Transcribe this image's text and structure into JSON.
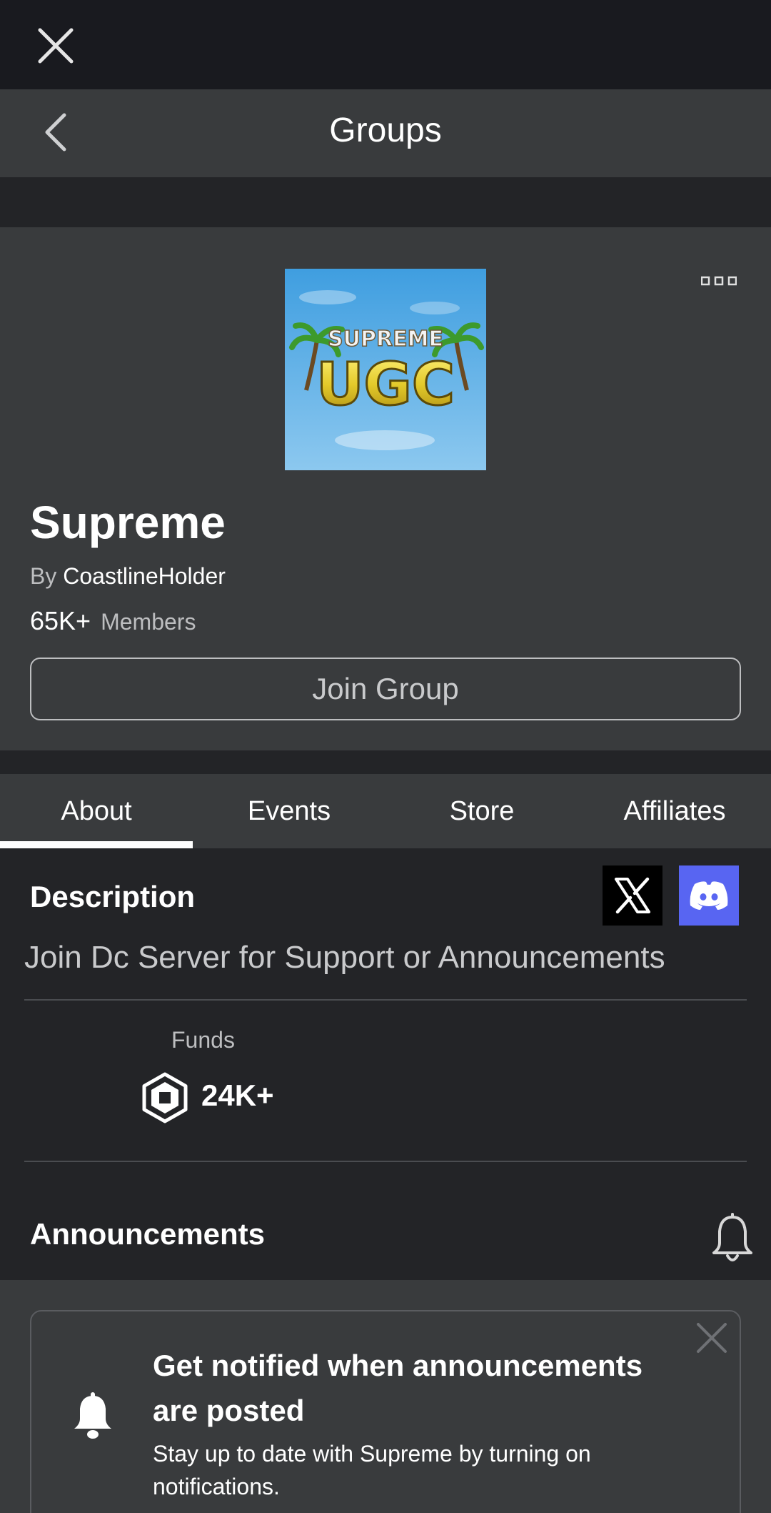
{
  "topbar": {
    "close_icon": "close-icon"
  },
  "navbar": {
    "title": "Groups",
    "back_icon": "chevron-left-icon"
  },
  "group": {
    "name": "Supreme",
    "by_prefix": "By",
    "owner": "CoastlineHolder",
    "members_count": "65K+",
    "members_label": "Members",
    "join_label": "Join Group",
    "image_alt": "SUPREME UGC",
    "more_icon": "more-options-icon"
  },
  "tabs": [
    {
      "label": "About",
      "active": true
    },
    {
      "label": "Events",
      "active": false
    },
    {
      "label": "Store",
      "active": false
    },
    {
      "label": "Affiliates",
      "active": false
    }
  ],
  "about": {
    "description_title": "Description",
    "description_text": "Join Dc Server for Support or Announcements",
    "social": [
      "x-icon",
      "discord-icon"
    ],
    "funds_label": "Funds",
    "funds_value": "24K+",
    "announcements_title": "Announcements"
  },
  "notify_card": {
    "title": "Get notified when announcements are posted",
    "body": "Stay up to date with Supreme by turning on notifications."
  },
  "colors": {
    "background": "#232427",
    "panel": "#393b3d",
    "topbar": "#191a1f",
    "discord": "#5865f2",
    "muted_text": "#bdbec0"
  }
}
